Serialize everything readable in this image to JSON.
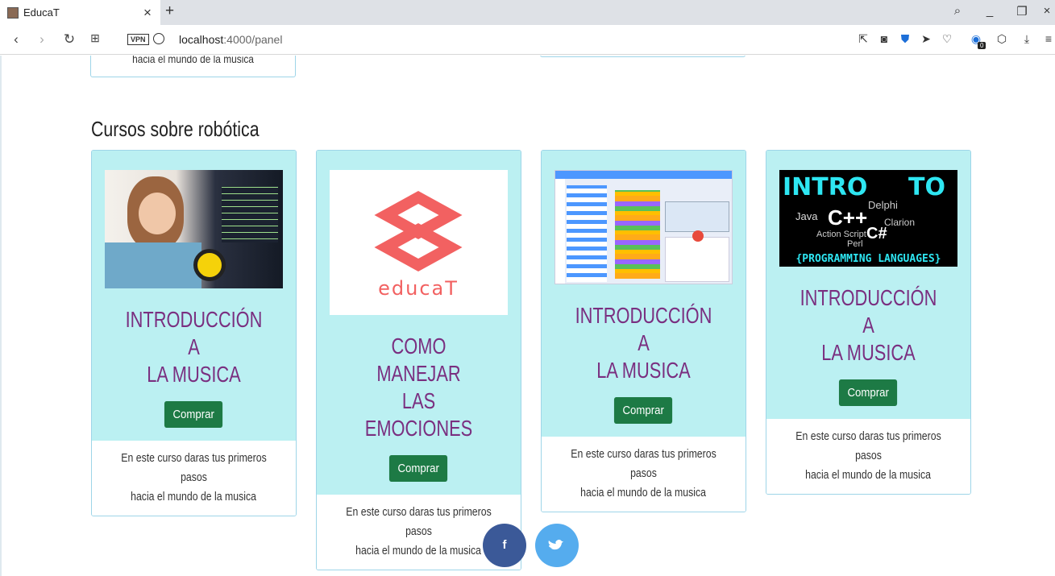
{
  "browser": {
    "tab_title": "EducaT",
    "url_host": "localhost",
    "url_path": ":4000/panel",
    "vpn_label": "VPN",
    "badge_count": "0"
  },
  "page": {
    "prev_card_text": "hacia el mundo de la musica",
    "section_title": "Cursos sobre robótica",
    "cards": [
      {
        "title_line1": "INTRODUCCIÓN A",
        "title_line2": "LA MUSICA",
        "button": "Comprar",
        "desc_line1": "En este curso daras tus primeros pasos",
        "desc_line2": "hacia el mundo de la musica",
        "image": "girl-robot-photo"
      },
      {
        "title_line1": "COMO MANEJAR",
        "title_line2": "LAS EMOCIONES",
        "button": "Comprar",
        "desc_line1": "En este curso daras tus primeros pasos",
        "desc_line2": "hacia el mundo de la musica",
        "image": "educat-logo",
        "logo_text": "educaT"
      },
      {
        "title_line1": "INTRODUCCIÓN A",
        "title_line2": "LA MUSICA",
        "button": "Comprar",
        "desc_line1": "En este curso daras tus primeros pasos",
        "desc_line2": "hacia el mundo de la musica",
        "image": "scratch-editor-screenshot"
      },
      {
        "title_line1": "INTRODUCCIÓN A",
        "title_line2": "LA MUSICA",
        "button": "Comprar",
        "desc_line1": "En este curso daras tus primeros pasos",
        "desc_line2": "hacia el mundo de la musica",
        "image": "intro-to-programming-languages",
        "img_title_left": "INTRO",
        "img_title_right": "TO",
        "img_footer": "{PROGRAMMING LANGUAGES}"
      }
    ],
    "social": {
      "facebook": "f",
      "twitter": "t"
    }
  },
  "colors": {
    "card_top_bg": "#bbf0f2",
    "title_color": "#7a2f80",
    "button_bg": "#1d7a45",
    "facebook": "#3b5998",
    "twitter": "#55acee"
  }
}
